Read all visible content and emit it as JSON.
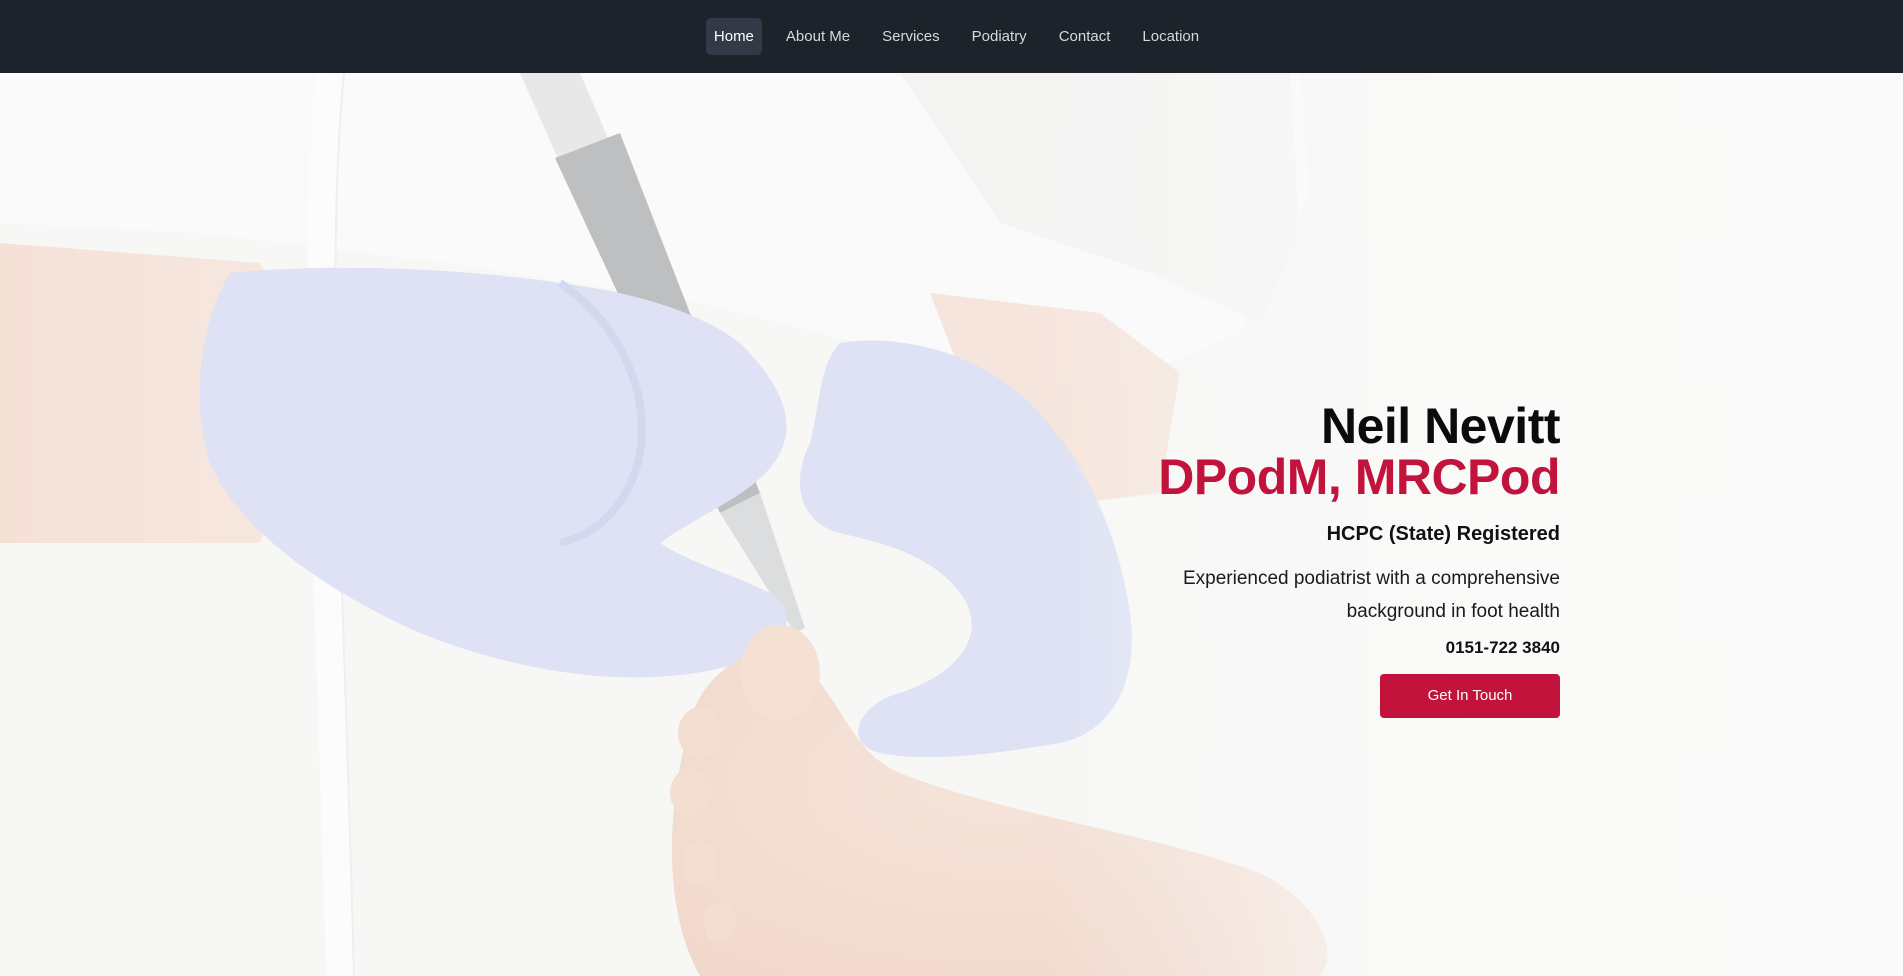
{
  "nav": {
    "items": [
      {
        "label": "Home",
        "active": true
      },
      {
        "label": "About Me",
        "active": false
      },
      {
        "label": "Services",
        "active": false
      },
      {
        "label": "Podiatry",
        "active": false
      },
      {
        "label": "Contact",
        "active": false
      },
      {
        "label": "Location",
        "active": false
      }
    ]
  },
  "hero": {
    "image": "podiatrist-treating-foot-photo",
    "name": "Neil Nevitt",
    "credentials": "DPodM, MRCPod",
    "registration": "HCPC (State) Registered",
    "description": "Experienced podiatrist with a comprehensive background in foot health",
    "phone": "0151-722 3840",
    "cta_label": "Get In Touch"
  },
  "colors": {
    "navbar": "#1c232b",
    "accent": "#c1133c",
    "nav_active": "#323a47"
  }
}
